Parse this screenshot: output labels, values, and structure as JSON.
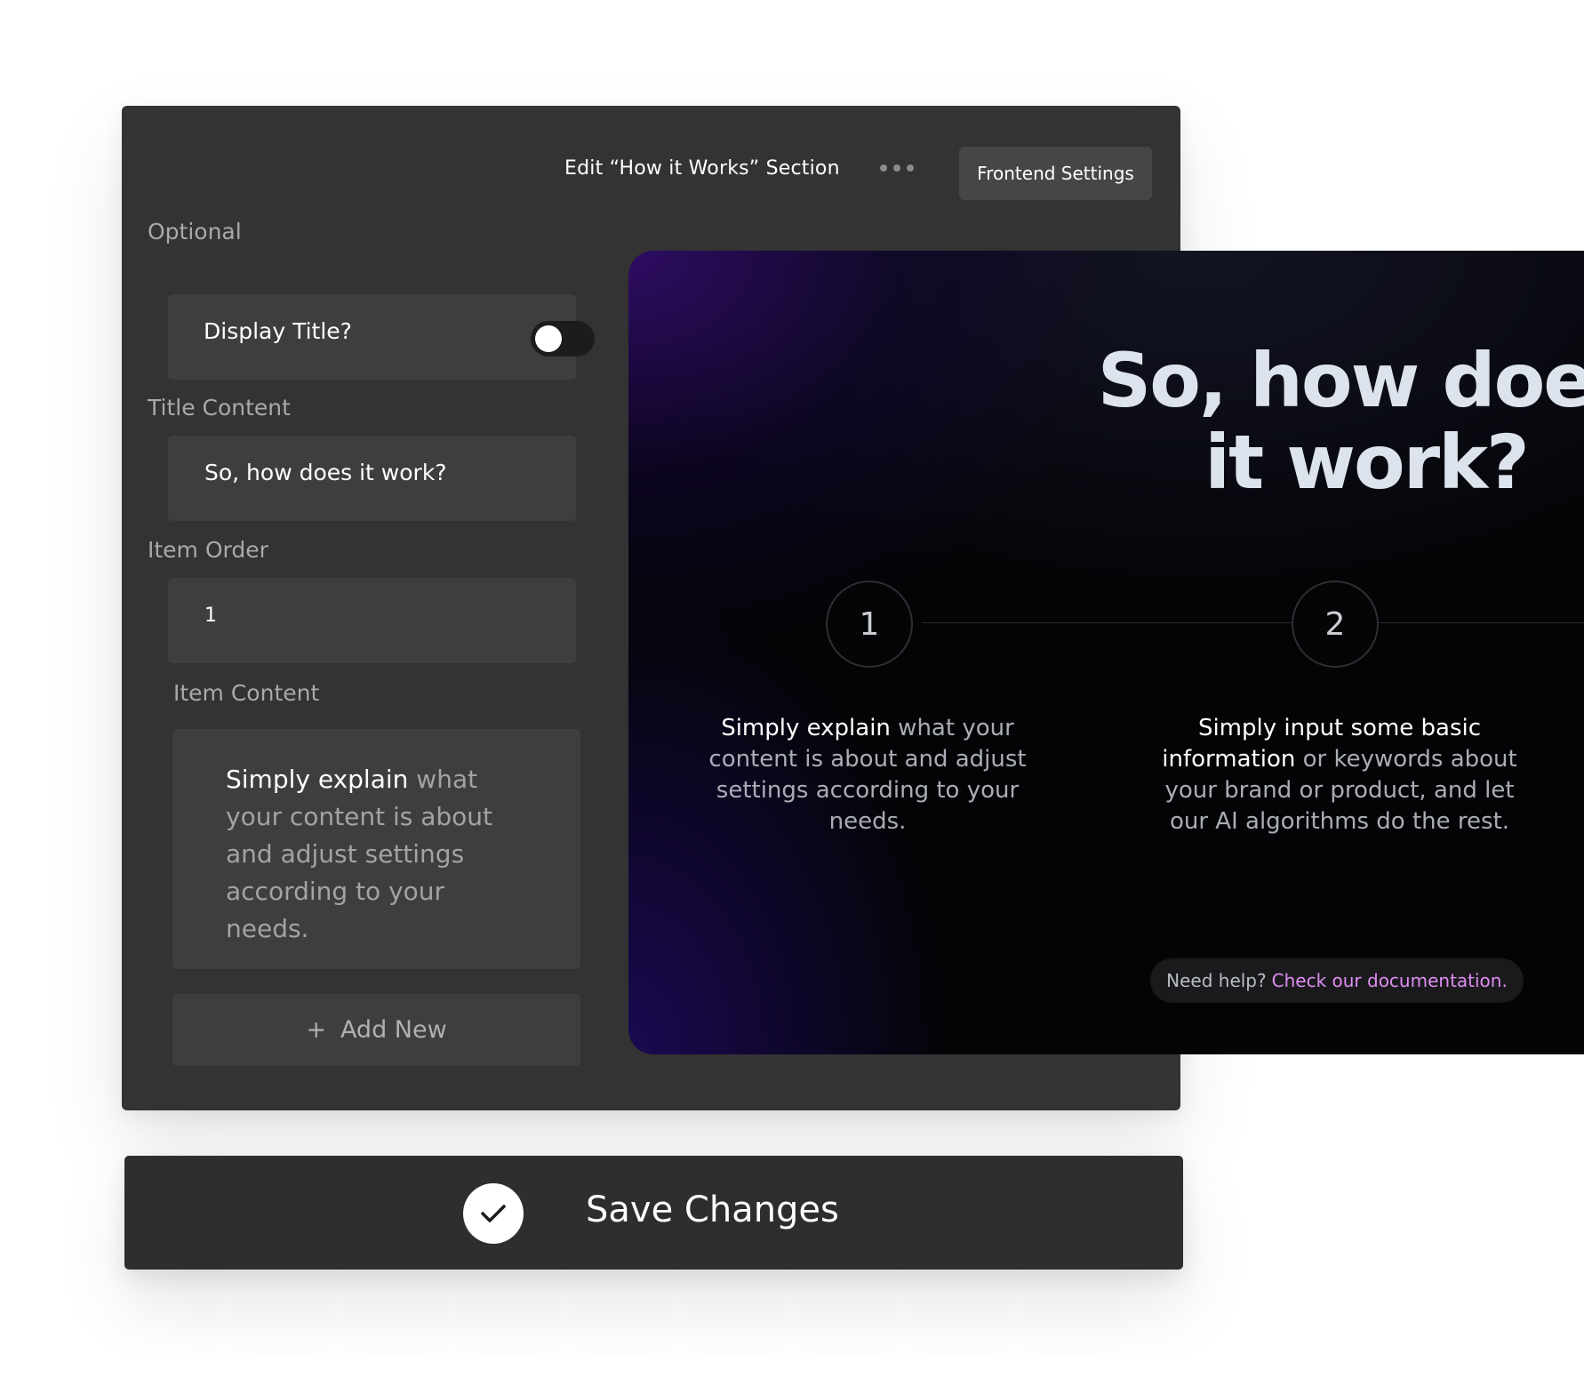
{
  "header": {
    "title": "Edit “How it Works” Section",
    "more_icon": "more-dots-icon",
    "frontend_settings_label": "Frontend Settings"
  },
  "form": {
    "optional_label": "Optional",
    "display_title": {
      "label": "Display Title?",
      "toggle_on": false
    },
    "title_content": {
      "label": "Title Content",
      "value": "So, how does it work?"
    },
    "item_order": {
      "label": "Item Order",
      "value": "1"
    },
    "item_content": {
      "label": "Item Content",
      "highlight": "Simply explain",
      "rest": " what your content is about and adjust settings according to your needs."
    },
    "add_new": {
      "icon": "plus-icon",
      "label": "Add New"
    }
  },
  "preview": {
    "title_line1": "So, how does",
    "title_line2": "it work?",
    "steps": [
      {
        "number": "1",
        "highlight": "Simply explain",
        "rest": " what your content is about and adjust settings according to your needs."
      },
      {
        "number": "2",
        "highlight": "Simply input some basic information",
        "rest": " or keywords about your brand or product, and let our AI algorithms do the rest."
      }
    ],
    "help_question": "Need help?",
    "help_link": "Check our documentation."
  },
  "save": {
    "icon": "checkmark-icon",
    "label": "Save Changes"
  },
  "colors": {
    "panel_bg": "#333333",
    "field_bg": "#3e3e3e",
    "save_bar_bg": "#2e2e2e",
    "link_accent": "#e08cf2",
    "preview_glow": "#3c0f82"
  }
}
